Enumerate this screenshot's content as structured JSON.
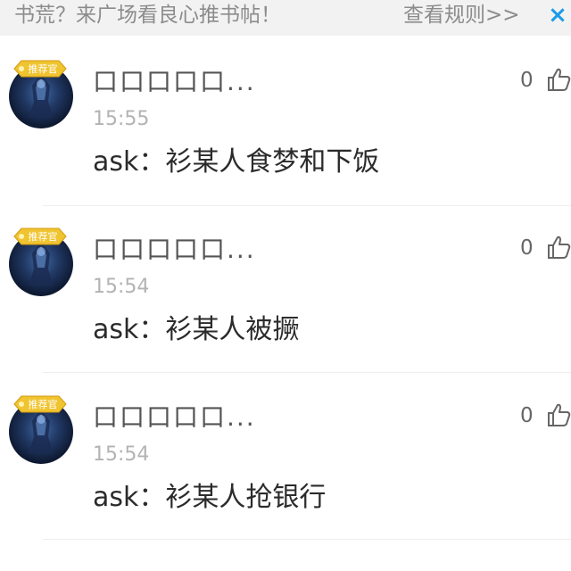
{
  "banner": {
    "text": "书荒？来广场看良心推书帖！",
    "link_label": "查看规则>>",
    "close_glyph": "×"
  },
  "colors": {
    "accent": "#1a9be8",
    "banner_bg": "#f2f2f2",
    "badge": "#f0c430"
  },
  "comments": [
    {
      "author": "口口口口口...",
      "badge": "推荐官",
      "time": "15:55",
      "text": "ask：衫某人食梦和下饭",
      "likes": "0",
      "like_icon": "thumbs-up-icon"
    },
    {
      "author": "口口口口口...",
      "badge": "推荐官",
      "time": "15:54",
      "text": "ask：衫某人被撅",
      "likes": "0",
      "like_icon": "thumbs-up-icon"
    },
    {
      "author": "口口口口口...",
      "badge": "推荐官",
      "time": "15:54",
      "text": "ask：衫某人抢银行",
      "likes": "0",
      "like_icon": "thumbs-up-icon"
    }
  ]
}
